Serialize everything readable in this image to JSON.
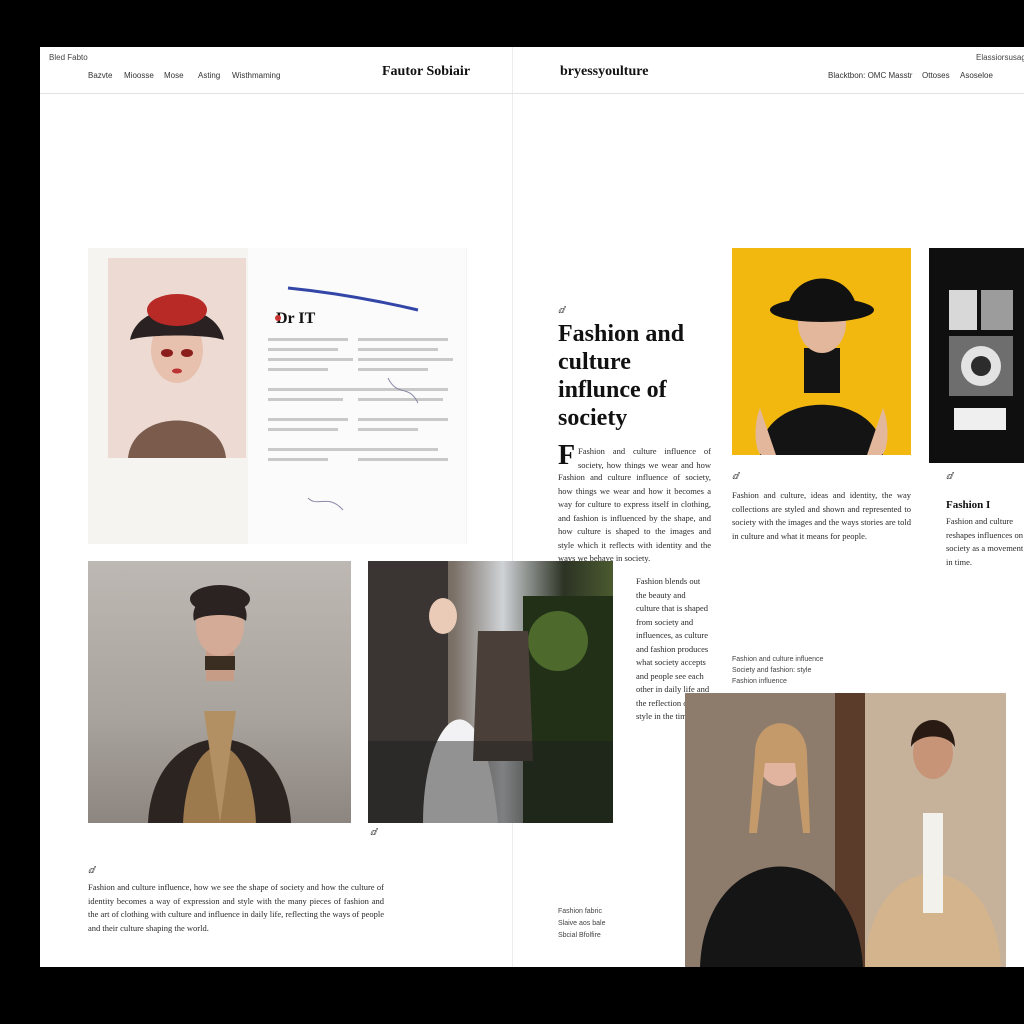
{
  "header": {
    "left_label": "Bled Fabto",
    "nav": [
      "Bazvte",
      "Mioosse",
      "Mose",
      "Asting",
      "Wisthmaming"
    ],
    "left_brand": "Fautor Sobiair",
    "right_brand": "bryessyoulture",
    "right_label": "Elassiorsusage",
    "right_nav": [
      "Blacktbon: OMC Masstr",
      "Ottoses",
      "Asoseloe"
    ]
  },
  "article": {
    "kicker": "ⅆ",
    "headline": "Fashion and culture influnce of society",
    "drop_cap": "F",
    "intro": "Fashion and culture influence of society, how things we wear and how it becomes a way for culture to express itself in clothing, and fashion is influenced by the shape, and how culture is shaped to the images and style which it reflects with identity and the ways we behave in society.",
    "column2": "Fashion blends out the beauty and culture that is shaped from society and influences, as culture and fashion produces what society accepts and people see each other in daily life and the reflection of a style in the time.",
    "column3": "Fashion and culture, ideas and identity, the way collections are styled and shown and represented to society with the images and the ways stories are told in culture and what it means for people.",
    "column4_title": "Fashion I",
    "column4": "Fashion and culture reshapes influences on society as a movement in time.",
    "bottom_intro": "Fashion and culture influence, how we see the shape of society and how the culture of identity becomes a way of expression and style with the many pieces of fashion and the art of clothing with culture and influence in daily life, reflecting the ways of people and their culture shaping the world."
  },
  "captions": {
    "collage": "Dr IT",
    "kicker2": "ⅆ",
    "kicker3": "ⅆ",
    "kicker4": "ⅆ",
    "kicker5": "ⅆ",
    "bottom_caption": [
      "Fashion fabric",
      "Slaive aos bale",
      "Sbcial Bfolfire"
    ],
    "mid_caption": [
      "Fashion and culture influence",
      "Society and fashion: style",
      "Fashion influence"
    ]
  },
  "colors": {
    "accent": "#f3b80f",
    "page": "#ffffff",
    "background": "#000000"
  }
}
